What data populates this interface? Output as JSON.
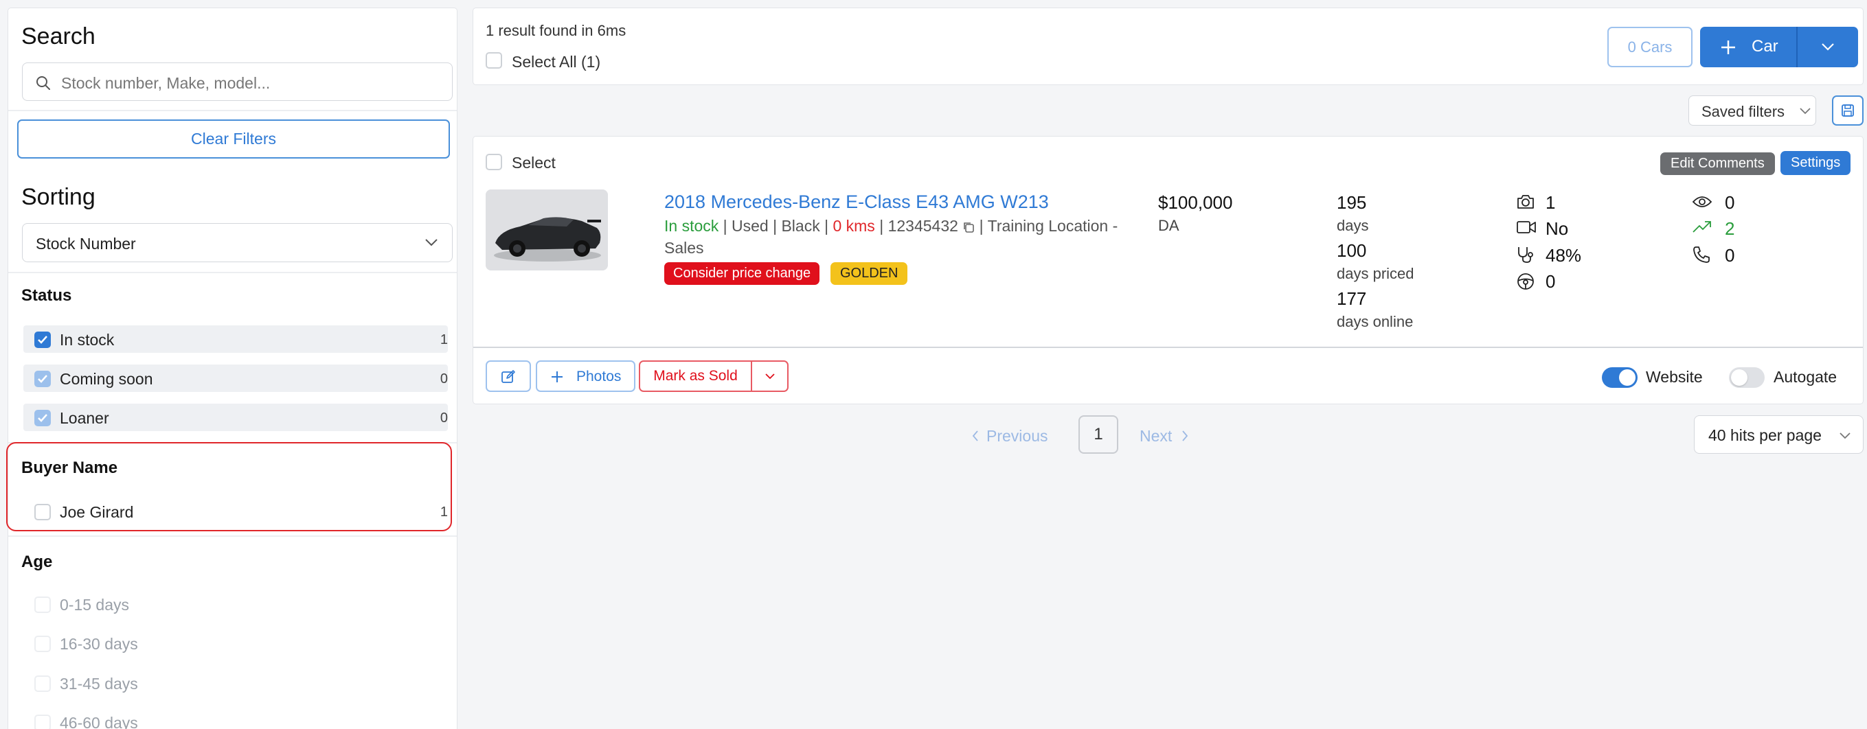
{
  "sidebar": {
    "search_title": "Search",
    "search_placeholder": "Stock number, Make, model...",
    "clear_filters": "Clear Filters",
    "sorting_title": "Sorting",
    "sort_value": "Stock Number",
    "status": {
      "title": "Status",
      "items": [
        {
          "label": "In stock",
          "count": "1"
        },
        {
          "label": "Coming soon",
          "count": "0"
        },
        {
          "label": "Loaner",
          "count": "0"
        }
      ]
    },
    "buyer": {
      "title": "Buyer Name",
      "items": [
        {
          "label": "Joe Girard",
          "count": "1"
        }
      ]
    },
    "age": {
      "title": "Age",
      "items": [
        {
          "label": "0-15 days"
        },
        {
          "label": "16-30 days"
        },
        {
          "label": "31-45 days"
        },
        {
          "label": "46-60 days"
        }
      ]
    }
  },
  "header": {
    "results_text": "1 result found in 6ms",
    "select_all": "Select All (1)",
    "cars_count": "0 Cars",
    "add_car": "Car"
  },
  "toolbar": {
    "saved_filters": "Saved filters"
  },
  "listing": {
    "select_label": "Select",
    "edit_comments": "Edit Comments",
    "settings": "Settings",
    "title": "2018 Mercedes-Benz E-Class E43 AMG W213",
    "status": "In stock",
    "details_1": " | Used | Black | ",
    "kms": "0 kms",
    "details_2": " | 12345432 ",
    "details_3": " | Training Location -",
    "details_4": "Sales",
    "badge_price": "Consider price change",
    "badge_golden": "GOLDEN",
    "price": "$100,000",
    "price_sub": "DA",
    "days_num": "195",
    "days_lbl": "days",
    "priced_num": "100",
    "priced_lbl": "days priced",
    "online_num": "177",
    "online_lbl": "days online",
    "photos_count": "1",
    "video": "No",
    "health": "48%",
    "steering": "0",
    "views": "0",
    "trend": "2",
    "calls": "0",
    "photos_btn": "Photos",
    "mark_sold": "Mark as Sold",
    "website": "Website",
    "autogate": "Autogate",
    "website_on": true,
    "autogate_on": false
  },
  "pagination": {
    "previous": "Previous",
    "page": "1",
    "next": "Next",
    "per_page": "40 hits per page"
  },
  "colors": {
    "accent": "#2f7ad5",
    "danger": "#e0262a",
    "success": "#2a9d3c",
    "golden": "#f3c21b"
  }
}
